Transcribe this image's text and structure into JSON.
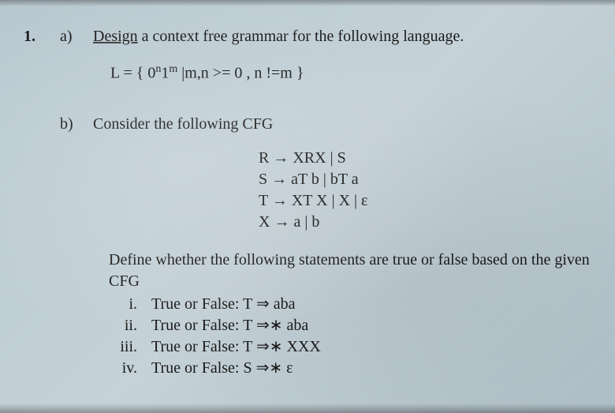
{
  "q_number": "1.",
  "part_a": "a)",
  "part_a_design": "Design",
  "part_a_rest": " a context free grammar for the following language.",
  "language_L": "L = { 0",
  "language_sup1": "n",
  "language_mid1": "1",
  "language_sup2": "m",
  "language_rest": " |m,n >= 0 , n !=m }",
  "part_b": "b)",
  "part_b_text": "Consider the following CFG",
  "grammar": {
    "l1": "R → XRX | S",
    "l2": "S → aT b | bT a",
    "l3": "T → XT X | X | ε",
    "l4": "X → a | b"
  },
  "define_text": "Define whether the following statements are true or false based on the given",
  "cfg_label": "CFG",
  "items": {
    "i_num": "i.",
    "i_text": "True or False: T ⇒ aba",
    "ii_num": "ii.",
    "ii_text": "True or False: T ⇒∗ aba",
    "iii_num": "iii.",
    "iii_text": "True or False: T ⇒∗ XXX",
    "iv_num": "iv.",
    "iv_text": "True or False: S ⇒∗ ε"
  }
}
